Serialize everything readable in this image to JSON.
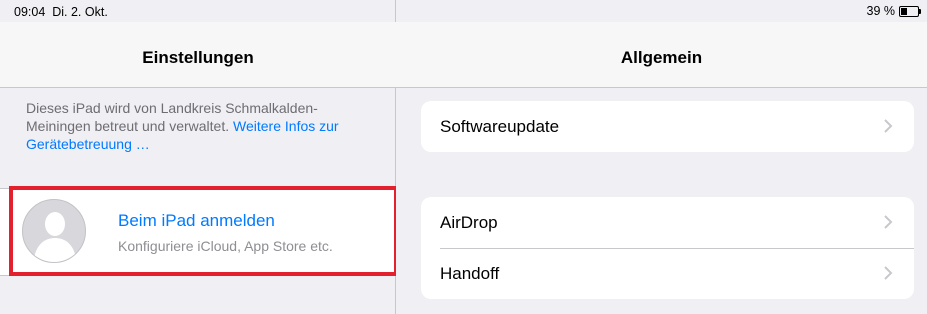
{
  "status_bar": {
    "time": "09:04",
    "date": "Di. 2. Okt.",
    "battery_percent": "39 %",
    "battery_level": 0.39
  },
  "master": {
    "title": "Einstellungen",
    "managed_text": "Dieses iPad wird von Landkreis Schmalkalden-Meiningen betreut und verwaltet.",
    "managed_link": "Weitere Infos zur Gerätebetreuung …",
    "signin": {
      "title": "Beim iPad anmelden",
      "subtitle": "Konfiguriere iCloud, App Store etc.",
      "avatar_icon": "person-silhouette-icon"
    }
  },
  "detail": {
    "title": "Allgemein",
    "groups": [
      {
        "rows": [
          "Softwareupdate"
        ]
      },
      {
        "rows": [
          "AirDrop",
          "Handoff"
        ]
      }
    ]
  },
  "colors": {
    "accent": "#007aff",
    "highlight": "#e3202e",
    "background": "#efeff4"
  }
}
